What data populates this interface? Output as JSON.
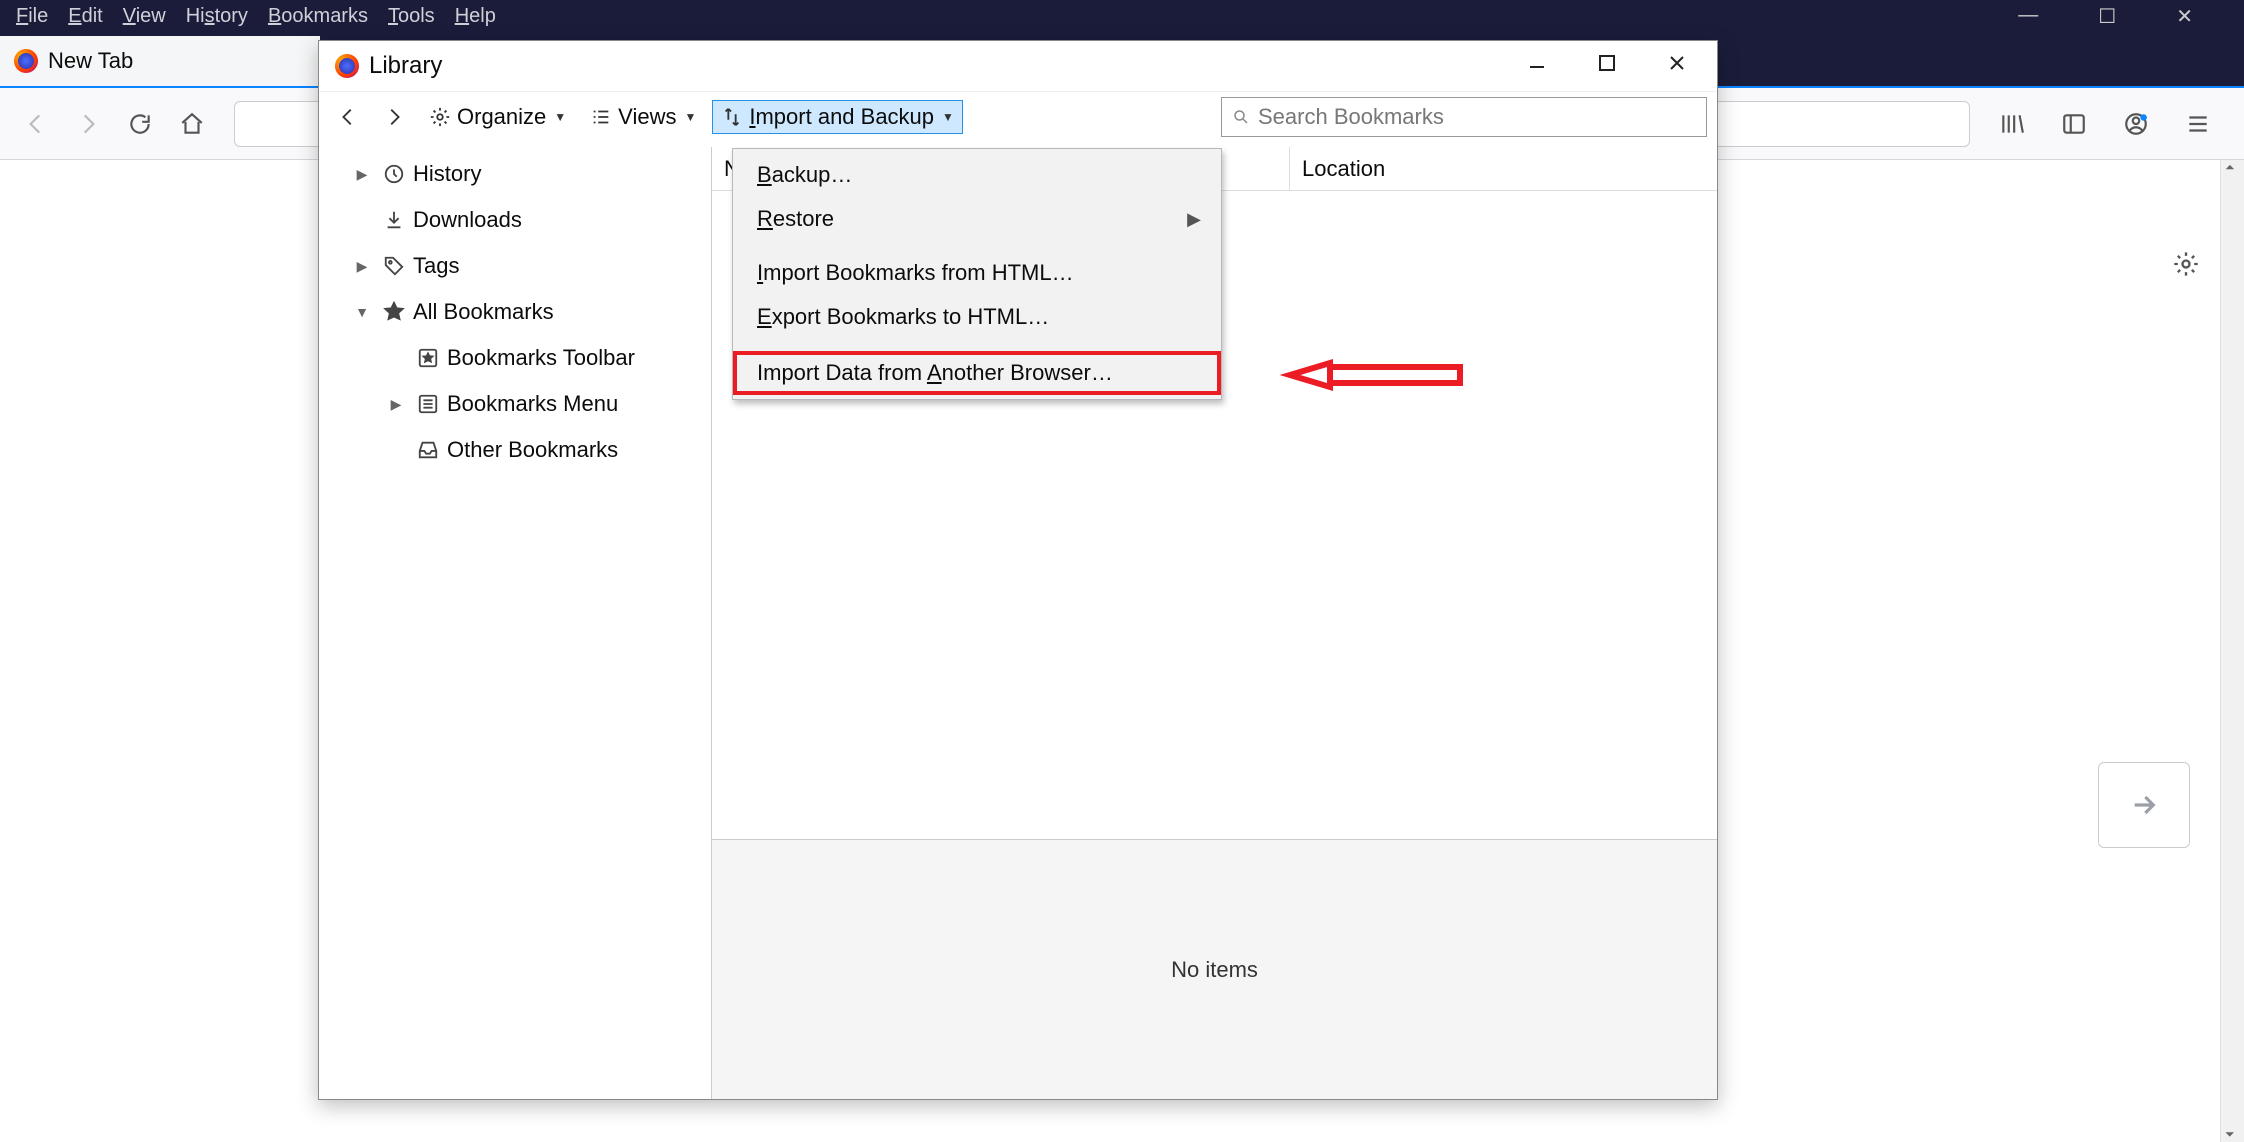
{
  "menubar": {
    "file": "File",
    "edit": "Edit",
    "view": "View",
    "history": "History",
    "bookmarks": "Bookmarks",
    "tools": "Tools",
    "help": "Help"
  },
  "main_window": {
    "tab_title": "New Tab"
  },
  "library": {
    "title": "Library",
    "toolbar": {
      "organize": "Organize",
      "views": "Views",
      "import_backup": "Import and Backup"
    },
    "search_placeholder": "Search Bookmarks",
    "tree": {
      "history": "History",
      "downloads": "Downloads",
      "tags": "Tags",
      "all_bookmarks": "All Bookmarks",
      "bookmarks_toolbar": "Bookmarks Toolbar",
      "bookmarks_menu": "Bookmarks Menu",
      "other_bookmarks": "Other Bookmarks"
    },
    "columns": {
      "name": "Name",
      "location": "Location"
    },
    "empty_details": "No items"
  },
  "dropdown": {
    "backup": "Backup…",
    "restore": "Restore",
    "import_html": "Import Bookmarks from HTML…",
    "export_html": "Export Bookmarks to HTML…",
    "import_another": "Import Data from Another Browser…"
  }
}
